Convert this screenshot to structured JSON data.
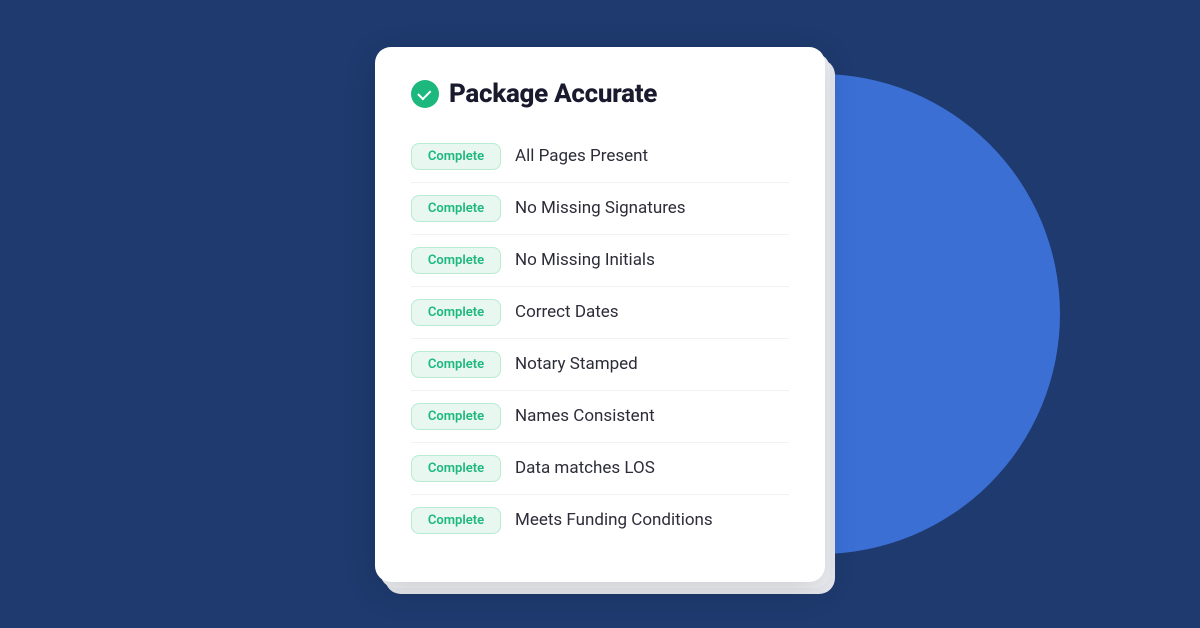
{
  "background": {
    "color": "#1e3a6e",
    "circle_color": "#3b6fd4"
  },
  "card": {
    "title": "Package Accurate",
    "check_icon_color": "#1db87e",
    "badge_label": "Complete",
    "items": [
      {
        "badge": "Complete",
        "label": "All Pages Present"
      },
      {
        "badge": "Complete",
        "label": "No Missing Signatures"
      },
      {
        "badge": "Complete",
        "label": "No Missing Initials"
      },
      {
        "badge": "Complete",
        "label": "Correct Dates"
      },
      {
        "badge": "Complete",
        "label": "Notary Stamped"
      },
      {
        "badge": "Complete",
        "label": "Names Consistent"
      },
      {
        "badge": "Complete",
        "label": "Data matches LOS"
      },
      {
        "badge": "Complete",
        "label": "Meets Funding Conditions"
      }
    ]
  }
}
